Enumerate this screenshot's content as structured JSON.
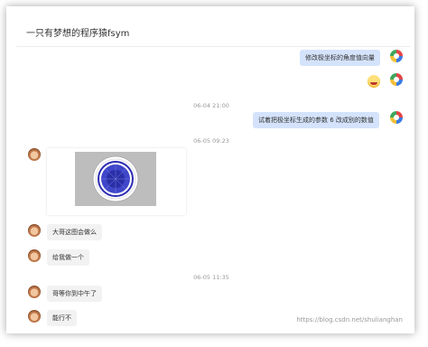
{
  "header": {
    "title": "一只有梦想的程序猿fsym"
  },
  "messages": [
    {
      "text": "修改极坐标的角度值向量"
    },
    {
      "text": "试着把极坐标生成的参数 6 改成别的数值"
    },
    {
      "text": "大哥这图会做么"
    },
    {
      "text": "给我做一个"
    },
    {
      "text": "哥等你到中午了"
    },
    {
      "text": "能行不"
    }
  ],
  "timestamps": [
    "06-04 21:00",
    "06-05 09:23",
    "06-05 11:35"
  ],
  "watermark": "https://blog.csdn.net/shulianghan",
  "colors": {
    "self_bubble": "#d4e3fb",
    "other_bubble": "#f2f2f2"
  }
}
